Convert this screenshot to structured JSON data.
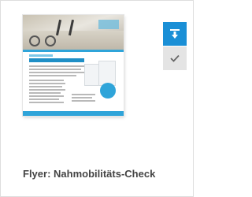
{
  "card": {
    "title": "Flyer: Nahmobilitäts-Check",
    "thumbnail_icon": "flyer-thumbnail-icon",
    "download_icon": "download-icon",
    "check_icon": "check-icon"
  },
  "colors": {
    "accent": "#1a8fd6",
    "check_button_bg": "#e4e4e4",
    "title_text": "#444444",
    "card_border": "#dedede"
  }
}
